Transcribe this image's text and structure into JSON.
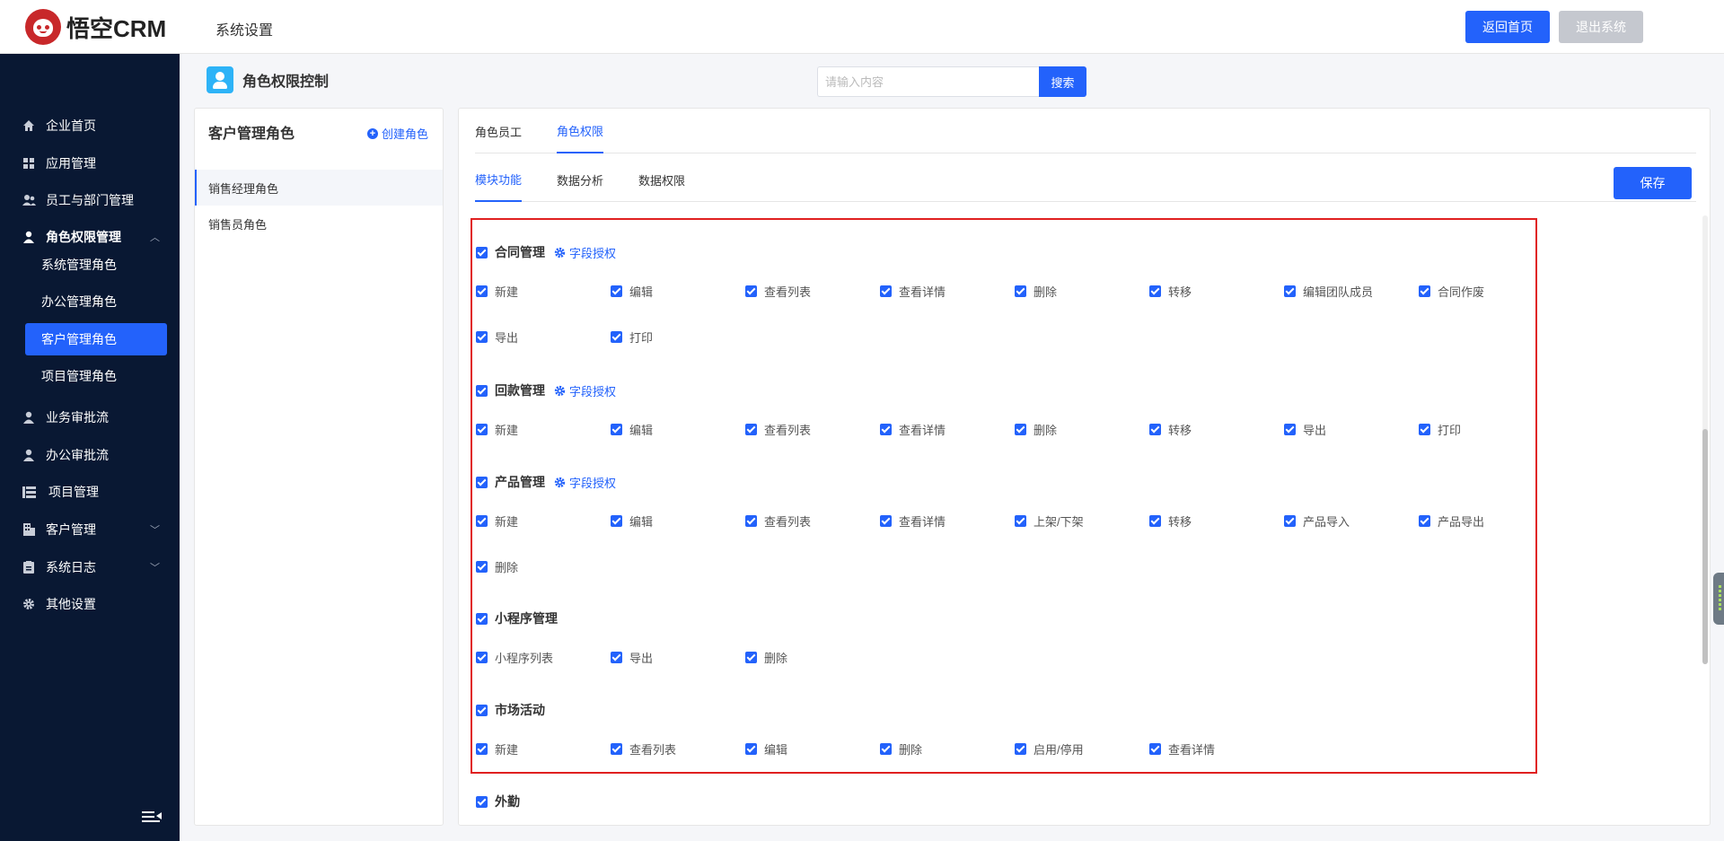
{
  "app": {
    "logo_text": "悟空CRM",
    "page_title": "系统设置",
    "home_button": "返回首页",
    "exit_button": "退出系统"
  },
  "sidebar": {
    "items": [
      {
        "label": "企业首页",
        "icon": "home-icon"
      },
      {
        "label": "应用管理",
        "icon": "grid-icon"
      },
      {
        "label": "员工与部门管理",
        "icon": "users-icon"
      },
      {
        "label": "角色权限管理",
        "icon": "user-icon",
        "expanded": true
      },
      {
        "label": "业务审批流",
        "icon": "user-icon"
      },
      {
        "label": "办公审批流",
        "icon": "user-icon"
      },
      {
        "label": "项目管理",
        "icon": "list-icon"
      },
      {
        "label": "客户管理",
        "icon": "building-icon"
      },
      {
        "label": "系统日志",
        "icon": "clipboard-icon"
      },
      {
        "label": "其他设置",
        "icon": "gear-icon"
      }
    ],
    "sub_items": [
      "系统管理角色",
      "办公管理角色",
      "客户管理角色",
      "项目管理角色"
    ],
    "active_sub": "客户管理角色"
  },
  "header": {
    "title": "角色权限控制",
    "search_placeholder": "请输入内容",
    "search_button": "搜索"
  },
  "roles": {
    "title": "客户管理角色",
    "create_label": "创建角色",
    "items": [
      "销售经理角色",
      "销售员角色"
    ],
    "selected": "销售经理角色"
  },
  "main": {
    "tabs": [
      "角色员工",
      "角色权限"
    ],
    "active_tab": "角色权限",
    "subtabs": [
      "模块功能",
      "数据分析",
      "数据权限"
    ],
    "active_subtab": "模块功能",
    "save_button": "保存",
    "field_auth_label": "字段授权",
    "groups": [
      {
        "title": "合同管理",
        "field_auth": true,
        "checked": true,
        "perms": [
          "新建",
          "编辑",
          "查看列表",
          "查看详情",
          "删除",
          "转移",
          "编辑团队成员",
          "合同作废",
          "导出",
          "打印"
        ]
      },
      {
        "title": "回款管理",
        "field_auth": true,
        "checked": true,
        "perms": [
          "新建",
          "编辑",
          "查看列表",
          "查看详情",
          "删除",
          "转移",
          "导出",
          "打印"
        ]
      },
      {
        "title": "产品管理",
        "field_auth": true,
        "checked": true,
        "perms": [
          "新建",
          "编辑",
          "查看列表",
          "查看详情",
          "上架/下架",
          "转移",
          "产品导入",
          "产品导出",
          "删除"
        ]
      },
      {
        "title": "小程序管理",
        "field_auth": false,
        "checked": true,
        "perms": [
          "小程序列表",
          "导出",
          "删除"
        ]
      },
      {
        "title": "市场活动",
        "field_auth": false,
        "checked": true,
        "perms": [
          "新建",
          "查看列表",
          "编辑",
          "删除",
          "启用/停用",
          "查看详情"
        ]
      },
      {
        "title": "外勤",
        "field_auth": false,
        "checked": true,
        "perms": []
      }
    ]
  },
  "colors": {
    "primary": "#2362fb",
    "sidebar_bg": "#091833",
    "highlight_border": "#e02020",
    "disabled_button": "#c5c8cf"
  }
}
